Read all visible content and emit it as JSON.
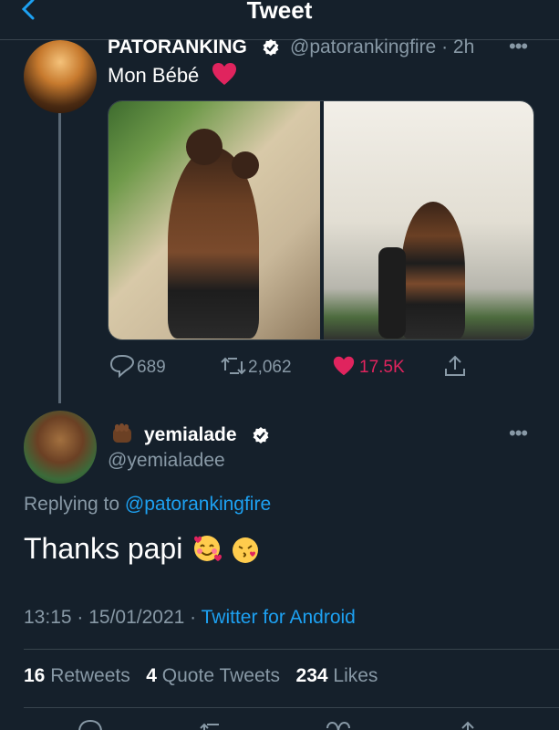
{
  "header": {
    "title": "Tweet"
  },
  "original_tweet": {
    "name": "PATORANKING",
    "handle": "@patorankingfire",
    "time": "· 2h",
    "text": "Mon Bébé",
    "replies": "689",
    "retweets": "2,062",
    "likes": "17.5K"
  },
  "reply_tweet": {
    "name": "yemialade",
    "handle": "@yemialadee",
    "replying_prefix": "Replying to",
    "replying_handle": "@patorankingfire",
    "text": "Thanks papi",
    "timestamp": "13:15 · 15/01/2021 ·",
    "source": "Twitter for Android",
    "retweets_count": "16",
    "retweets_label": "Retweets",
    "quote_count": "4",
    "quote_label": "Quote Tweets",
    "likes_count": "234",
    "likes_label": "Likes"
  },
  "colors": {
    "background": "#15202b",
    "accent": "#1da1f2",
    "like": "#e0245e",
    "secondary_text": "#8899a6",
    "verified": "#ffffff"
  },
  "icons": [
    "back-chevron-icon",
    "verified-badge-icon",
    "more-icon",
    "reply-icon",
    "retweet-icon",
    "heart-icon",
    "share-icon"
  ]
}
